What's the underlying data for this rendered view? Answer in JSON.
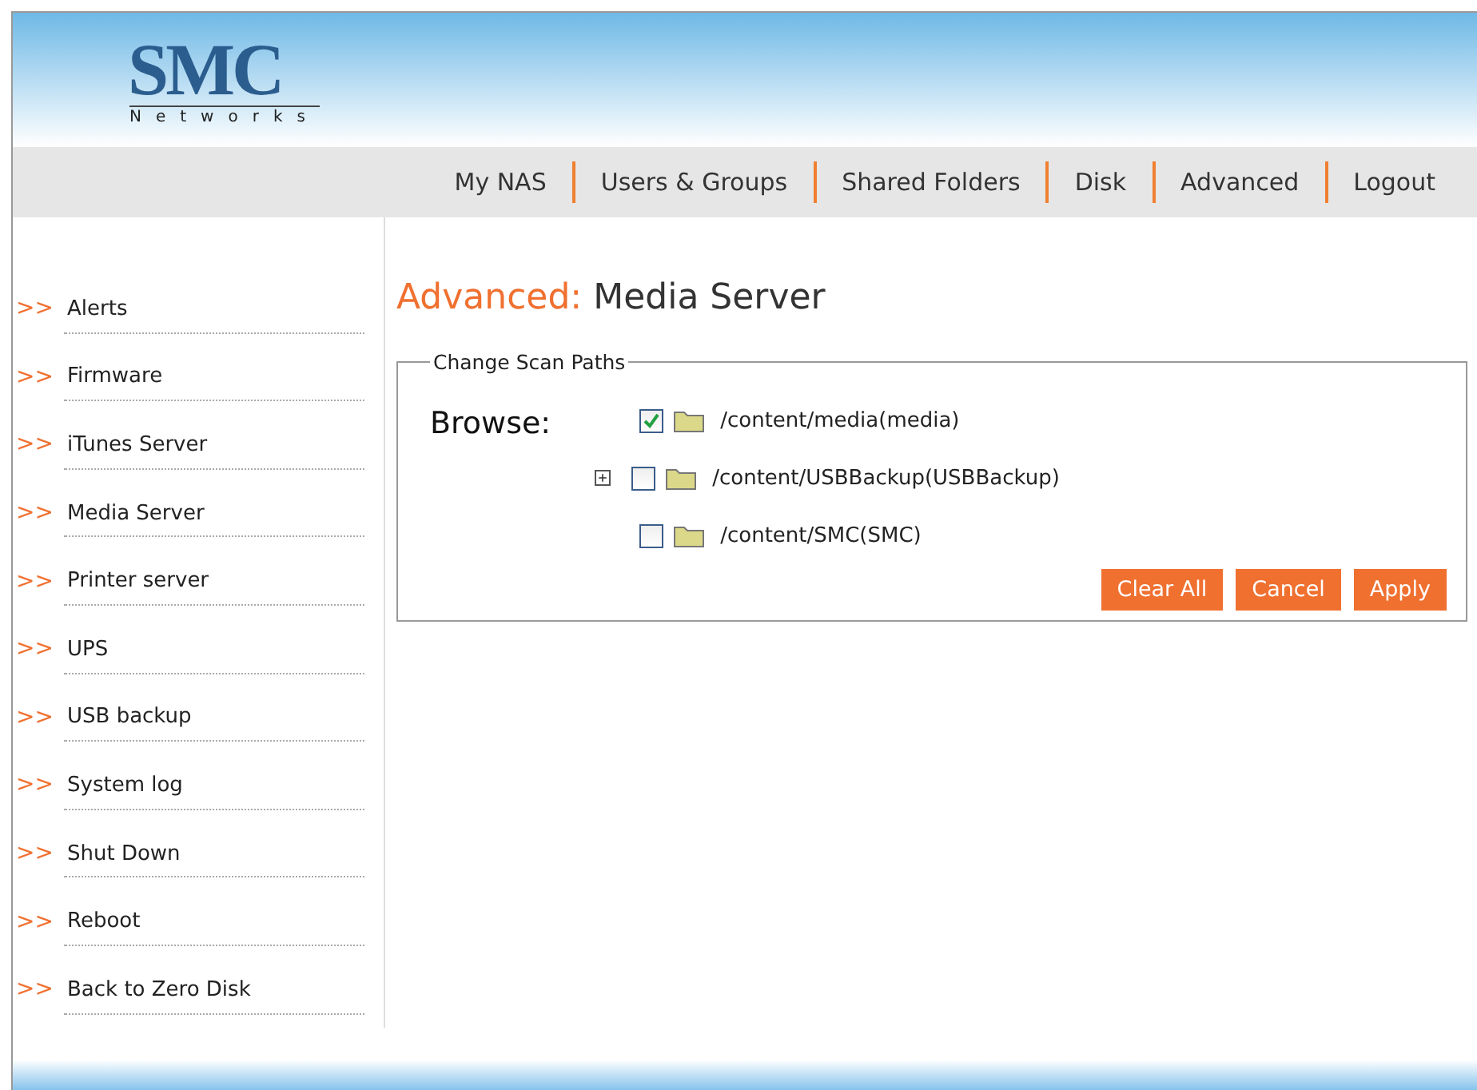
{
  "logo": {
    "brand": "SMC",
    "tagline": "Networks"
  },
  "nav": [
    {
      "label": "My NAS"
    },
    {
      "label": "Users & Groups"
    },
    {
      "label": "Shared Folders"
    },
    {
      "label": "Disk"
    },
    {
      "label": "Advanced"
    },
    {
      "label": "Logout"
    }
  ],
  "sidebar": {
    "marker": ">>",
    "items": [
      {
        "label": "Alerts"
      },
      {
        "label": "Firmware"
      },
      {
        "label": "iTunes Server"
      },
      {
        "label": "Media Server"
      },
      {
        "label": "Printer server"
      },
      {
        "label": "UPS"
      },
      {
        "label": "USB backup"
      },
      {
        "label": "System log"
      },
      {
        "label": "Shut Down"
      },
      {
        "label": "Reboot"
      },
      {
        "label": "Back to Zero Disk"
      }
    ]
  },
  "page_title": {
    "section": "Advanced:",
    "name": "Media Server"
  },
  "panel": {
    "legend": "Change Scan Paths",
    "browse_label": "Browse:",
    "paths": [
      {
        "path": "/content/media(media)",
        "checked": true,
        "expandable": false
      },
      {
        "path": "/content/USBBackup(USBBackup)",
        "checked": false,
        "expandable": true
      },
      {
        "path": "/content/SMC(SMC)",
        "checked": false,
        "expandable": false
      }
    ],
    "buttons": [
      "Clear All",
      "Cancel",
      "Apply"
    ]
  }
}
